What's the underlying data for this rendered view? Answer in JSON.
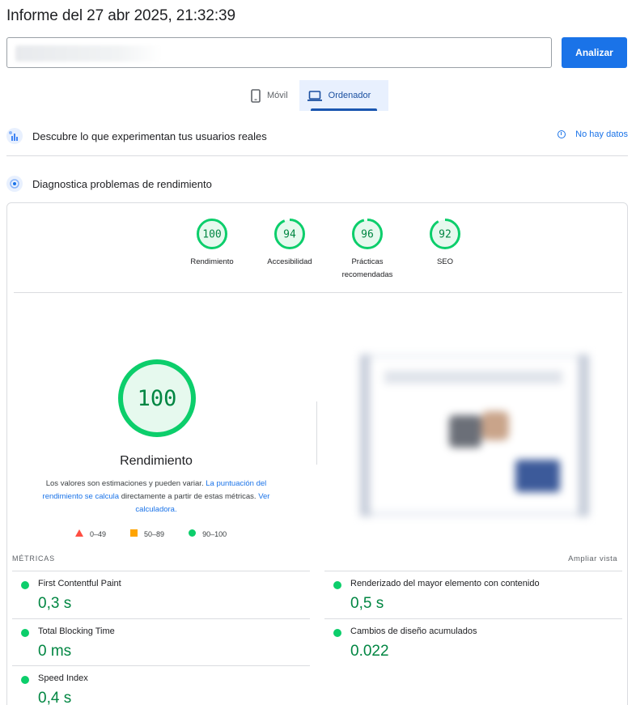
{
  "header": {
    "title": "Informe del 27 abr 2025, 21:32:39"
  },
  "url_input": {
    "value": ""
  },
  "analyze_button": {
    "label": "Analizar"
  },
  "device_tabs": [
    {
      "label": "Móvil",
      "icon": "smartphone-icon",
      "active": false
    },
    {
      "label": "Ordenador",
      "icon": "laptop-icon",
      "active": true
    }
  ],
  "crux_section": {
    "title": "Descubre lo que experimentan tus usuarios reales",
    "status": "No hay datos"
  },
  "diagnostics_section": {
    "title": "Diagnostica problemas de rendimiento"
  },
  "categories": [
    {
      "score": "100",
      "label": "Rendimiento"
    },
    {
      "score": "94",
      "label": "Accesibilidad"
    },
    {
      "score": "96",
      "label": "Prácticas recomendadas"
    },
    {
      "score": "92",
      "label": "SEO"
    }
  ],
  "performance": {
    "score": "100",
    "title": "Rendimiento",
    "desc_pre": "Los valores son estimaciones y pueden variar. ",
    "desc_link1": "La puntuación del rendimiento se calcula",
    "desc_mid": " directamente a partir de estas métricas. ",
    "desc_link2": "Ver calculadora."
  },
  "legend": [
    {
      "range": "0–49",
      "shape": "triangle",
      "color": "#ff4e42"
    },
    {
      "range": "50–89",
      "shape": "square",
      "color": "#ffa400"
    },
    {
      "range": "90–100",
      "shape": "circle",
      "color": "#0cce6b"
    }
  ],
  "metrics": {
    "heading": "MÉTRICAS",
    "expand_label": "Ampliar vista",
    "items": [
      {
        "name": "First Contentful Paint",
        "value": "0,3 s"
      },
      {
        "name": "Renderizado del mayor elemento con contenido",
        "value": "0,5 s"
      },
      {
        "name": "Total Blocking Time",
        "value": "0 ms"
      },
      {
        "name": "Cambios de diseño acumulados",
        "value": "0.022"
      },
      {
        "name": "Speed Index",
        "value": "0,4 s"
      }
    ]
  },
  "colors": {
    "pass": "#0cce6b",
    "pass_text": "#018642",
    "pass_bg": "#e6f9ee",
    "accent": "#1a73e8"
  }
}
